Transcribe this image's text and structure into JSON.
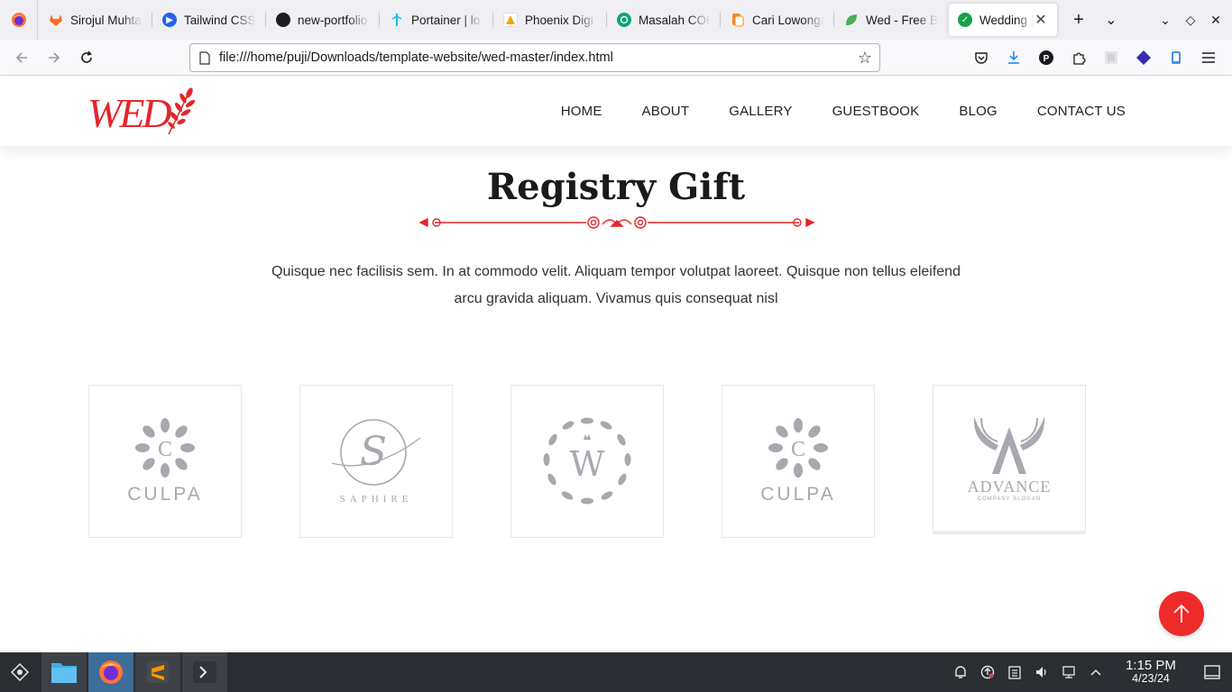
{
  "browser": {
    "tabs": [
      {
        "title": "Sirojul Muhta",
        "favicon": "gitlab-icon",
        "color": "#fc6d26"
      },
      {
        "title": "Tailwind CSS",
        "favicon": "youtube-play-icon",
        "color": "#2563eb"
      },
      {
        "title": "new-portfolio",
        "favicon": "github-icon",
        "color": "#1b1f23"
      },
      {
        "title": "Portainer | lo",
        "favicon": "portainer-icon",
        "color": "#13bef9"
      },
      {
        "title": "Phoenix Digi",
        "favicon": "phoenix-icon",
        "color": "#f6a21c"
      },
      {
        "title": "Masalah COR",
        "favicon": "chatgpt-icon",
        "color": "#10a37f"
      },
      {
        "title": "Cari Lowonga",
        "favicon": "glints-icon",
        "color": "#f28b24"
      },
      {
        "title": "Wed - Free B",
        "favicon": "leaf-icon",
        "color": "#4caf50"
      },
      {
        "title": "Wedding |",
        "favicon": "check-circle-icon",
        "color": "#15a34a",
        "active": true
      }
    ],
    "url": "file:///home/puji/Downloads/template-website/wed-master/index.html"
  },
  "site": {
    "logo_text": "WED",
    "nav": [
      "HOME",
      "ABOUT",
      "GALLERY",
      "GUESTBOOK",
      "BLOG",
      "CONTACT US"
    ],
    "section_title": "Registry Gift",
    "section_description": "Quisque nec facilisis sem. In at commodo velit. Aliquam tempor volutpat laoreet. Quisque non tellus eleifend arcu gravida aliquam. Vivamus quis consequat nisl",
    "partners": [
      {
        "name": "CULPA",
        "icon": "culpa-flower-logo"
      },
      {
        "name": "SAPHIRE",
        "icon": "saphire-s-logo"
      },
      {
        "name": "W",
        "icon": "w-wreath-logo"
      },
      {
        "name": "CULPA",
        "icon": "culpa-flower-logo"
      },
      {
        "name": "ADVANCE",
        "tagline": "COMPANY SLOGAN",
        "icon": "advance-wings-logo"
      }
    ],
    "accent_color": "#e5262b"
  },
  "taskbar": {
    "time": "1:15 PM",
    "date": "4/23/24"
  }
}
